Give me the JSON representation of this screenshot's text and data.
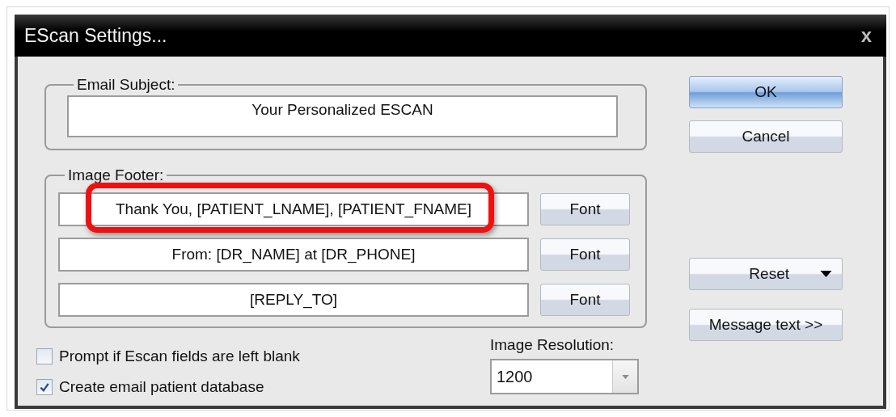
{
  "window": {
    "title": "EScan Settings...",
    "close": "x"
  },
  "email_subject": {
    "label": "Email Subject:",
    "value": "Your Personalized ESCAN"
  },
  "image_footer": {
    "label": "Image Footer:",
    "lines": [
      {
        "value": "Thank You, [PATIENT_LNAME], [PATIENT_FNAME]",
        "button": "Font",
        "highlighted": true
      },
      {
        "value": "From: [DR_NAME] at [DR_PHONE]",
        "button": "Font",
        "highlighted": false
      },
      {
        "value": "[REPLY_TO]",
        "button": "Font",
        "highlighted": false
      }
    ]
  },
  "options": [
    {
      "label": "Prompt if Escan fields are left blank",
      "checked": false
    },
    {
      "label": "Create email patient database",
      "checked": true
    }
  ],
  "image_resolution": {
    "label": "Image Resolution:",
    "value": "1200"
  },
  "buttons": [
    {
      "label": "OK",
      "kind": "default"
    },
    {
      "label": "Cancel",
      "kind": "plain"
    },
    {
      "label": "Reset",
      "kind": "dropdown"
    },
    {
      "label": "Message text >>",
      "kind": "plain"
    }
  ]
}
